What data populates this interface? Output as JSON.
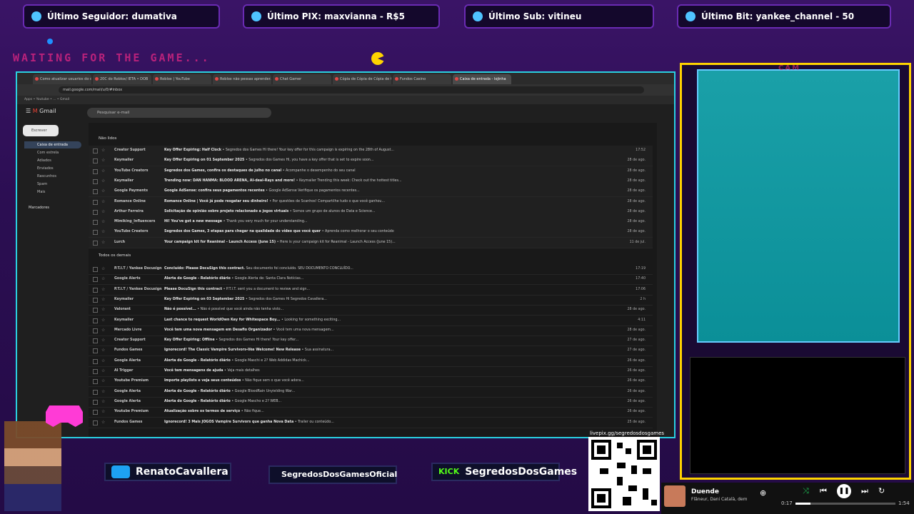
{
  "overlay": {
    "top_bars": [
      {
        "label": "Último Seguidor: dumativa"
      },
      {
        "label": "Último PIX: maxvianna - R$5"
      },
      {
        "label": "Último Sub: vitineu"
      },
      {
        "label": "Último Bit: yankee_channel - 50"
      }
    ],
    "waiting_text": "WAITING FOR THE GAME...",
    "cam_label": "CAM",
    "socials": {
      "twitter": "RenatoCavallera",
      "instagram": "SegredosDosGamesOficial",
      "kick_tag": "KICK",
      "kick": "SegredosDosGames"
    },
    "qr_label": "livepix.gg/segredosdosgames",
    "music": {
      "title": "Duende",
      "artist": "Flâneur, Dani Català, dem",
      "elapsed": "0:17",
      "duration": "1:54",
      "progress": 0.15
    }
  },
  "browser": {
    "url": "mail.google.com/mail/u/0/#inbox",
    "tabs": [
      "Como atualizar usuarios do di...",
      "20C do Roblox/ IETA • DOB",
      "Roblox | YouTube",
      "Roblox não pessas aprender...",
      "Chat Gamer",
      "Cópia de Cópia de Cópia de Cl",
      "Fundos Casino",
      "Caixa de entrada - lojinha"
    ],
    "bookmarks": "Apps • Youtube • ... • Gmail",
    "gmail": {
      "logo": "Gmail",
      "search_placeholder": "Pesquisar e-mail",
      "compose": "Escrever",
      "sidebar": [
        "Caixa de entrada",
        "Com estrela",
        "Adiados",
        "Enviados",
        "Rascunhos",
        "Spam",
        "Mais"
      ],
      "labels_header": "Marcadores",
      "section_unread": "Não lidos",
      "section_all": "Todos os demais",
      "unread_rows": [
        {
          "sender": "Creator Support",
          "subject": "Key Offer Expiring: Half Clock",
          "snippet": "• Segredos dos Games Hi there! Your key offer for this campaign is expiring on the 28th of August...",
          "date": "17:52"
        },
        {
          "sender": "Keymailer",
          "subject": "Key Offer Expiring on 01 September 2025",
          "snippet": "• Segredos dos Games Hi, you have a key offer that is set to expire soon...",
          "date": "28 de ago."
        },
        {
          "sender": "YouTube Creators",
          "subject": "Segredos dos Games, confira os destaques de julho no canal",
          "snippet": "• Acompanhe o desempenho do seu canal",
          "date": "28 de ago."
        },
        {
          "sender": "Keymailer",
          "subject": "Trending now: DAN HANMA: BLOOD ARENA, AI-deal-Rays and more!",
          "snippet": "• Keymailer Trending this week: Check out the hottest titles...",
          "date": "28 de ago."
        },
        {
          "sender": "Google Payments",
          "subject": "Google AdSense: confira seus pagamentos recentes",
          "snippet": "• Google AdSense Verifique os pagamentos recentes...",
          "date": "28 de ago."
        },
        {
          "sender": "Romance Online",
          "subject": "Romance Online | Você já pode resgatar seu dinheiro!",
          "snippet": "• Por questões de Scanhos! Compartilhe tudo o que você ganhou...",
          "date": "28 de ago."
        },
        {
          "sender": "Arthur Ferreira",
          "subject": "Solicitação de opinião sobre projeto relacionado a jogos virtuais",
          "snippet": "• Somos um grupo de alunos de Data e Science...",
          "date": "28 de ago."
        },
        {
          "sender": "Mimiking_Influencers",
          "subject": "Hi! You've got a new message",
          "snippet": "• Thank you very much for your understanding...",
          "date": "28 de ago."
        },
        {
          "sender": "YouTube Creators",
          "subject": "Segredos dos Games, 3 etapas para chegar na qualidade do vídeo que você quer",
          "snippet": "• Aprenda como melhorar o seu conteúdo",
          "date": "28 de ago."
        },
        {
          "sender": "Lurch",
          "subject": "Your campaign kit for Reanimal - Launch Access (June 15)",
          "snippet": "• Here is your campaign kit for Reanimal - Launch Access (June 15)...",
          "date": "11 de jul."
        }
      ],
      "all_rows": [
        {
          "sender": "P.T.I.T / Yankee Docusign",
          "subject": "Concluído: Please DocuSign this contract.",
          "snippet": "Seu documento foi concluído. SEU DOCUMENTO CONCLUÍDO...",
          "date": "17:19"
        },
        {
          "sender": "Google Alerts",
          "subject": "Alerta do Google - Relatório diário",
          "snippet": "• Google Alerta de: Santa Clara Notícias...",
          "date": "17:40"
        },
        {
          "sender": "P.T.I.T / Yankee Docusign",
          "subject": "Please DocuSign this contract",
          "snippet": "• P.T.I.T. sent you a document to review and sign...",
          "date": "17:06"
        },
        {
          "sender": "Keymailer",
          "subject": "Key Offer Expiring on 03 September 2025",
          "snippet": "• Segredos dos Games Hi Segredos Cavallera...",
          "date": "2 h"
        },
        {
          "sender": "Valorant",
          "subject": "Não é possível...",
          "snippet": "• Não é possível que você ainda não tenha visto...",
          "date": "28 de ago."
        },
        {
          "sender": "Keymailer",
          "subject": "Last chance to request WorldOwn Key for Whitespace Boy...",
          "snippet": "• Looking for something exciting...",
          "date": "4:11"
        },
        {
          "sender": "Mercado Livre",
          "subject": "Você tem uma nova mensagem em Desafio Organizador",
          "snippet": "• Você tem uma nova mensagem...",
          "date": "28 de ago."
        },
        {
          "sender": "Creator Support",
          "subject": "Key Offer Expiring: Offline",
          "snippet": "• Segredos dos Games Hi there! Your key offer...",
          "date": "27 de ago."
        },
        {
          "sender": "Fundos Games",
          "subject": "Ignorecord! The Classic Vampire Survivors-like Welcome! New Release",
          "snippet": "• Sua assinatura...",
          "date": "27 de ago."
        },
        {
          "sender": "Google Alerta",
          "subject": "Alerta do Google - Relatório diário",
          "snippet": "• Google Maschi e 2? Web Addidas Machick...",
          "date": "26 de ago."
        },
        {
          "sender": "AI Trigger",
          "subject": "Você tem mensagens de ajuda",
          "snippet": "• Veja mais detalhes",
          "date": "26 de ago."
        },
        {
          "sender": "Youtube Premium",
          "subject": "Importe playlists e veja seus conteúdos",
          "snippet": "• Não fique sem o que você adora...",
          "date": "26 de ago."
        },
        {
          "sender": "Google Alerta",
          "subject": "Alerta do Google - Relatório diário",
          "snippet": "• Google BloodRain Unyielding War...",
          "date": "26 de ago."
        },
        {
          "sender": "Google Alerta",
          "subject": "Alerta do Google - Relatório diário",
          "snippet": "• Google Mascho e 2? WEB...",
          "date": "26 de ago."
        },
        {
          "sender": "Youtube Premium",
          "subject": "Atualização sobre os termos de serviço",
          "snippet": "• Não fique...",
          "date": "26 de ago."
        },
        {
          "sender": "Fundos Games",
          "subject": "Ignorecord! 3 Mais JOGOS Vampire Survivors que ganha Nova Data",
          "snippet": "• Trailer ou conteúdo...",
          "date": "25 de ago."
        }
      ]
    }
  },
  "colors": {
    "accent_cyan": "#2ad0e0",
    "accent_yellow": "#ffd400",
    "accent_pink": "#ff2a8a"
  }
}
